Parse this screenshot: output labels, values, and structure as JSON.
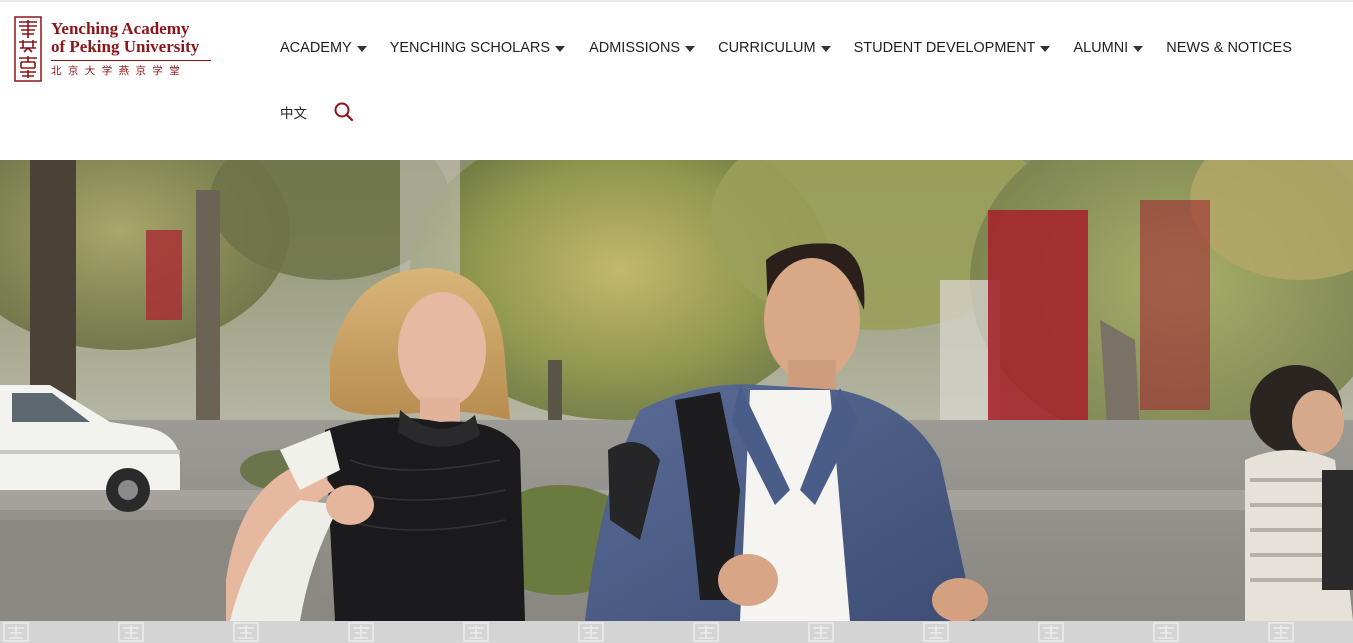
{
  "logo": {
    "title_line1": "Yenching Academy",
    "title_line2": "of Peking University",
    "chinese_name": "北京大学燕京学堂",
    "brand_color": "#8b1519"
  },
  "nav": {
    "items": [
      {
        "label": "ACADEMY",
        "has_dropdown": true
      },
      {
        "label": "YENCHING SCHOLARS",
        "has_dropdown": true
      },
      {
        "label": "ADMISSIONS",
        "has_dropdown": true
      },
      {
        "label": "CURRICULUM",
        "has_dropdown": true
      },
      {
        "label": "STUDENT DEVELOPMENT",
        "has_dropdown": true
      },
      {
        "label": "ALUMNI",
        "has_dropdown": true
      },
      {
        "label": "NEWS & NOTICES",
        "has_dropdown": false
      }
    ],
    "language_switch": "中文",
    "search_icon": "search-icon"
  },
  "hero": {
    "image": "hero-photo"
  },
  "colors": {
    "accent": "#8b1519",
    "nav_text": "#222222",
    "strip": "#d4d4d4"
  }
}
